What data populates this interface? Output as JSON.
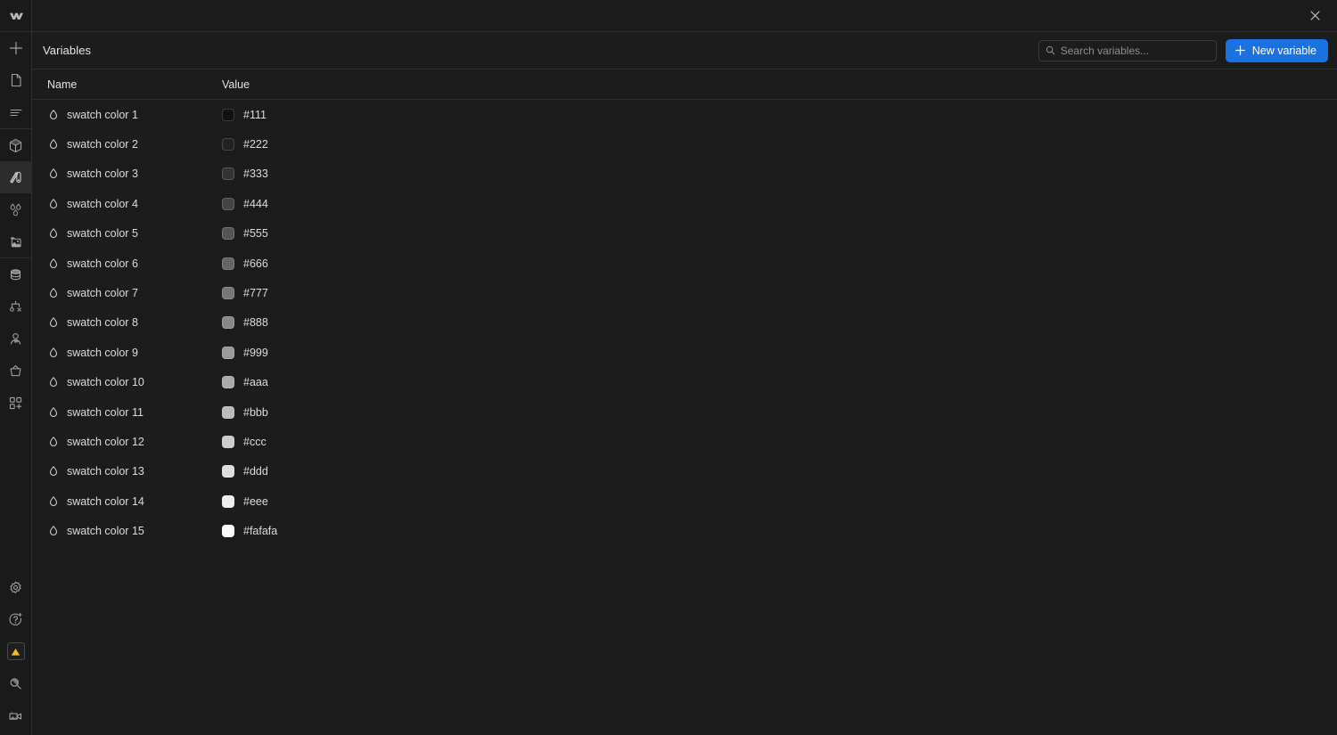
{
  "app": {
    "logo_icon": "webflow-logo-icon",
    "background": "#1c1c1c",
    "accent": "#1a72e0"
  },
  "titlebar": {
    "close_icon": "close-icon"
  },
  "rail": {
    "items": [
      {
        "icon": "plus-add-icon",
        "name": "rail-item-add",
        "active": false
      },
      {
        "icon": "page-document-icon",
        "name": "rail-item-pages",
        "active": false
      },
      {
        "icon": "navigator-layers-icon",
        "name": "rail-item-navigator",
        "active": false
      },
      {
        "icon": "components-cube-icon",
        "name": "rail-item-components",
        "active": false
      },
      {
        "icon": "style-selector-icon",
        "name": "rail-item-styles",
        "active": true
      },
      {
        "icon": "variables-droplets-icon",
        "name": "rail-item-variables",
        "active": false
      },
      {
        "icon": "assets-image-icon",
        "name": "rail-item-assets",
        "active": false
      },
      {
        "icon": "cms-database-icon",
        "name": "rail-item-cms",
        "active": false
      },
      {
        "icon": "logic-flow-icon",
        "name": "rail-item-logic",
        "active": false
      },
      {
        "icon": "users-person-icon",
        "name": "rail-item-users",
        "active": false
      },
      {
        "icon": "ecommerce-basket-icon",
        "name": "rail-item-ecommerce",
        "active": false
      },
      {
        "icon": "apps-grid-plus-icon",
        "name": "rail-item-apps",
        "active": false
      }
    ],
    "bottom_items": [
      {
        "icon": "settings-gear-icon",
        "name": "rail-item-settings"
      },
      {
        "icon": "help-question-icon",
        "name": "rail-item-help"
      },
      {
        "icon": "warning-triangle-icon",
        "name": "rail-item-audit",
        "badge_color": "#ffc107"
      },
      {
        "icon": "search-magnifier-icon",
        "name": "rail-item-search"
      },
      {
        "icon": "video-camera-icon",
        "name": "rail-item-video"
      }
    ]
  },
  "panel": {
    "title": "Variables",
    "search": {
      "placeholder": "Search variables...",
      "value": "",
      "icon": "search-icon"
    },
    "new_button": {
      "label": "New variable",
      "icon": "plus-icon"
    }
  },
  "table": {
    "columns": [
      "Name",
      "Value"
    ],
    "rows": [
      {
        "icon": "droplet-icon",
        "name": "swatch color 1",
        "value": "#111",
        "swatch": "#111111"
      },
      {
        "icon": "droplet-icon",
        "name": "swatch color 2",
        "value": "#222",
        "swatch": "#222222"
      },
      {
        "icon": "droplet-icon",
        "name": "swatch color 3",
        "value": "#333",
        "swatch": "#333333"
      },
      {
        "icon": "droplet-icon",
        "name": "swatch color 4",
        "value": "#444",
        "swatch": "#444444"
      },
      {
        "icon": "droplet-icon",
        "name": "swatch color 5",
        "value": "#555",
        "swatch": "#555555"
      },
      {
        "icon": "droplet-icon",
        "name": "swatch color 6",
        "value": "#666",
        "swatch": "#666666"
      },
      {
        "icon": "droplet-icon",
        "name": "swatch color 7",
        "value": "#777",
        "swatch": "#777777"
      },
      {
        "icon": "droplet-icon",
        "name": "swatch color 8",
        "value": "#888",
        "swatch": "#888888"
      },
      {
        "icon": "droplet-icon",
        "name": "swatch color 9",
        "value": "#999",
        "swatch": "#999999"
      },
      {
        "icon": "droplet-icon",
        "name": "swatch color 10",
        "value": "#aaa",
        "swatch": "#aaaaaa"
      },
      {
        "icon": "droplet-icon",
        "name": "swatch color 11",
        "value": "#bbb",
        "swatch": "#bbbbbb"
      },
      {
        "icon": "droplet-icon",
        "name": "swatch color 12",
        "value": "#ccc",
        "swatch": "#cccccc"
      },
      {
        "icon": "droplet-icon",
        "name": "swatch color 13",
        "value": "#ddd",
        "swatch": "#dddddd"
      },
      {
        "icon": "droplet-icon",
        "name": "swatch color 14",
        "value": "#eee",
        "swatch": "#eeeeee"
      },
      {
        "icon": "droplet-icon",
        "name": "swatch color 15",
        "value": "#fafafa",
        "swatch": "#fafafa"
      }
    ]
  }
}
